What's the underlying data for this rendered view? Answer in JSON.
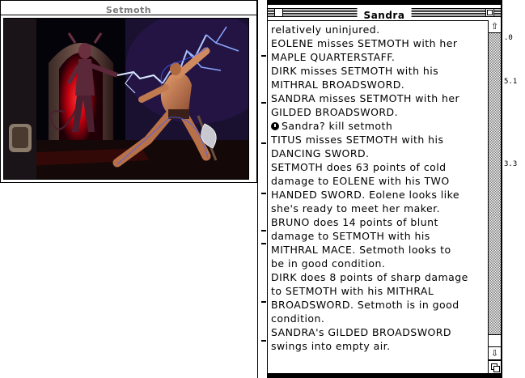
{
  "left_window": {
    "title": "Setmoth",
    "artwork_alt": "illustration of Setmoth battling a warrior"
  },
  "right_window": {
    "title": "Sandra",
    "log": [
      {
        "text": "relatively uninjured."
      },
      {
        "text": "EOLENE misses SETMOTH with her"
      },
      {
        "text": "MAPLE QUARTERSTAFF."
      },
      {
        "text": "DIRK misses SETMOTH with his"
      },
      {
        "text": "MITHRAL BROADSWORD."
      },
      {
        "text": "SANDRA misses SETMOTH with her"
      },
      {
        "text": "GILDED BROADSWORD."
      },
      {
        "text": "Sandra? kill setmoth",
        "prompt": true
      },
      {
        "text": "TITUS misses SETMOTH with his"
      },
      {
        "text": "DANCING SWORD."
      },
      {
        "text": "SETMOTH does 63 points of cold"
      },
      {
        "text": "damage to EOLENE with his TWO"
      },
      {
        "text": "HANDED SWORD.  Eolene looks like"
      },
      {
        "text": "she's ready to meet her maker."
      },
      {
        "text": "BRUNO does 14 points of blunt"
      },
      {
        "text": "damage to SETMOTH with his"
      },
      {
        "text": "MITHRAL MACE.  Setmoth looks to"
      },
      {
        "text": "be in good condition."
      },
      {
        "text": "DIRK does 8 points of sharp damage"
      },
      {
        "text": "to SETMOTH with his MITHRAL"
      },
      {
        "text": "BROADSWORD.  Setmoth is in good"
      },
      {
        "text": "condition."
      },
      {
        "text": "SANDRA's GILDED BROADSWORD"
      },
      {
        "text": "swings into empty air."
      }
    ],
    "scrollbar": {
      "up_glyph": "⇧",
      "down_glyph": "⇩",
      "position_fraction": 1.0
    }
  },
  "right_strip_labels": [
    ".0",
    "5.1",
    "3.3"
  ],
  "colors": {
    "title_inactive": "#7a7a7a",
    "window_bg": "#ffffff",
    "desktop": "#000000"
  }
}
